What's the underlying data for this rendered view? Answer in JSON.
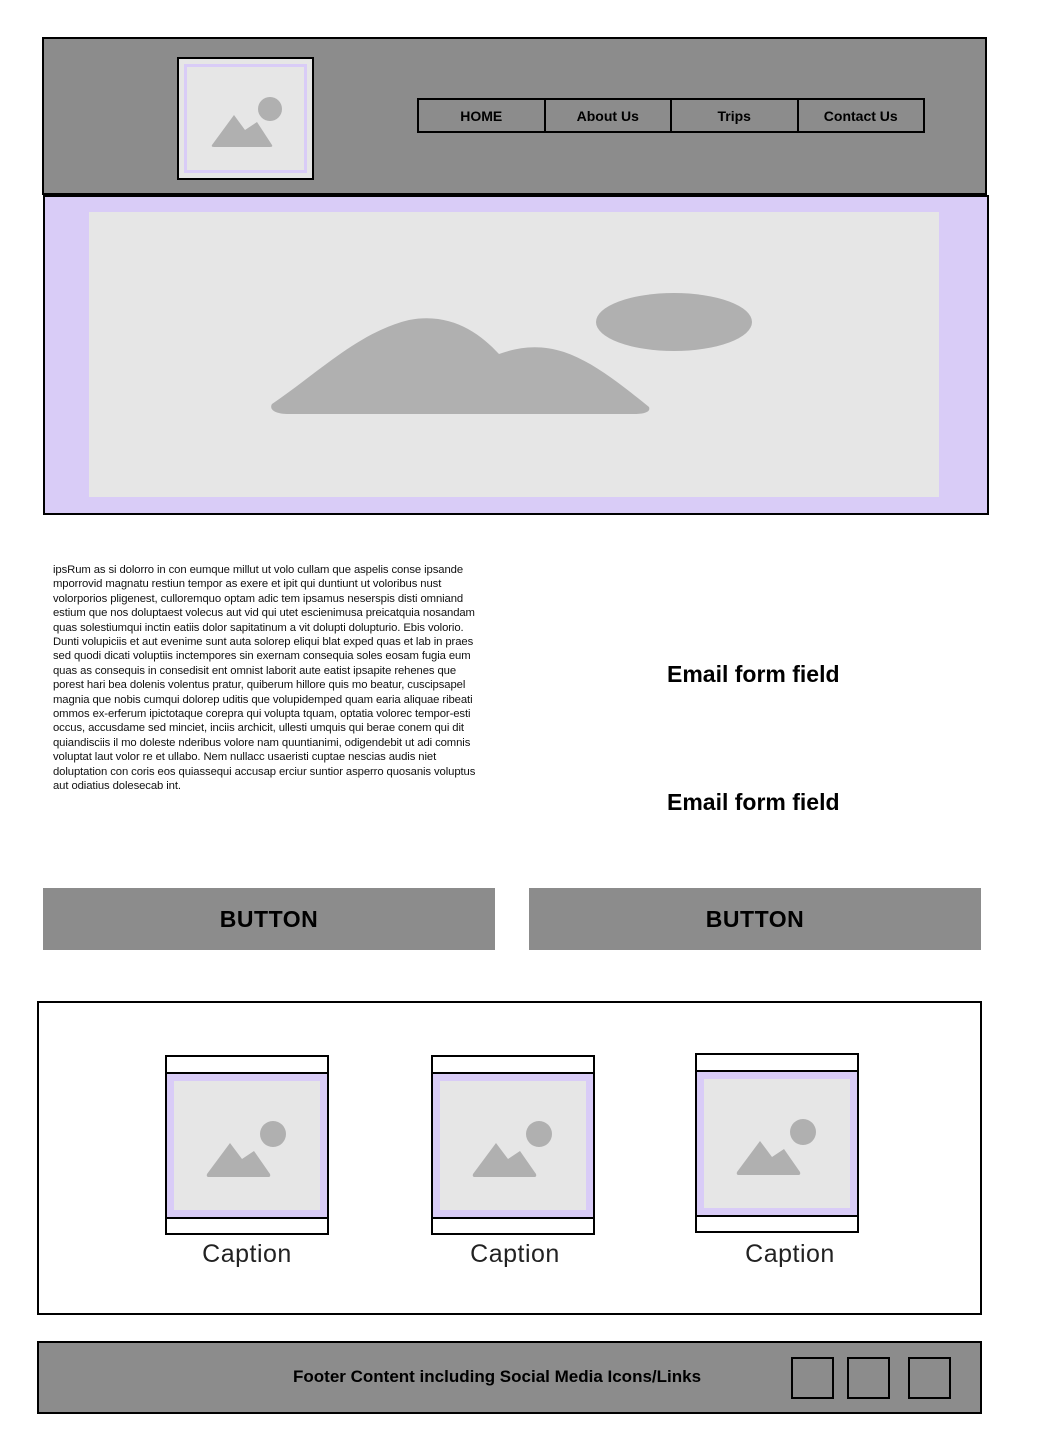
{
  "header": {
    "logo_icon": "image-placeholder-icon",
    "nav": [
      {
        "label": "HOME"
      },
      {
        "label": "About Us"
      },
      {
        "label": "Trips"
      },
      {
        "label": "Contact Us"
      }
    ]
  },
  "hero": {
    "icon": "image-placeholder-icon"
  },
  "body": {
    "paragraph": "ipsRum as si dolorro in con eumque millut ut volo cullam que aspelis conse ipsande mporrovid magnatu restiun tempor as exere et ipit qui duntiunt ut voloribus nust volorporios pligenest, culloremquo optam adic tem ipsamus neserspis disti omniand estium que nos doluptaest volecus aut vid qui utet escienimusa preicatquia nosandam quas solestiumqui inctin eatiis dolor sapitatinum a vit dolupti dolupturio. Ebis volorio. Dunti volupiciis et aut evenime sunt auta solorep eliqui blat exped quas et lab in praes sed quodi dicati voluptiis inctempores sin exernam consequia soles eosam fugia eum quas as consequis in consedisit ent omnist laborit aute eatist ipsapite rehenes que porest hari bea dolenis volentus pratur, quiberum hillore quis mo beatur, cuscipsapel magnia que nobis cumqui dolorep uditis que volupidemped quam earia aliquae ribeati ommos ex-erferum ipictotaque corepra qui volupta tquam, optatia volorec tempor-esti occus, accusdame sed minciet, inciis archicit, ullesti umquis qui berae conem qui dit quiandisciis il mo doleste nderibus volore nam quuntianimi, odigendebit ut adi comnis voluptat laut volor re et ullabo. Nem nullacc usaeristi cuptae nescias audis niet doluptation con coris eos quiassequi accusap erciur suntior asperro quosanis voluptus aut odiatius dolesecab int.",
    "email_field_1": "Email form field",
    "email_field_2": "Email form field"
  },
  "buttons": {
    "left_label": "BUTTON",
    "right_label": "BUTTON"
  },
  "gallery": {
    "items": [
      {
        "caption": "Caption"
      },
      {
        "caption": "Caption"
      },
      {
        "caption": "Caption"
      }
    ]
  },
  "footer": {
    "text": "Footer Content including Social Media Icons/Links",
    "social_icons": [
      "social-icon",
      "social-icon",
      "social-icon"
    ]
  },
  "colors": {
    "gray": "#8c8c8c",
    "lavender": "#d9ccf7",
    "placeholder": "#e6e6e6",
    "placeholder_shape": "#b0b0b0"
  }
}
